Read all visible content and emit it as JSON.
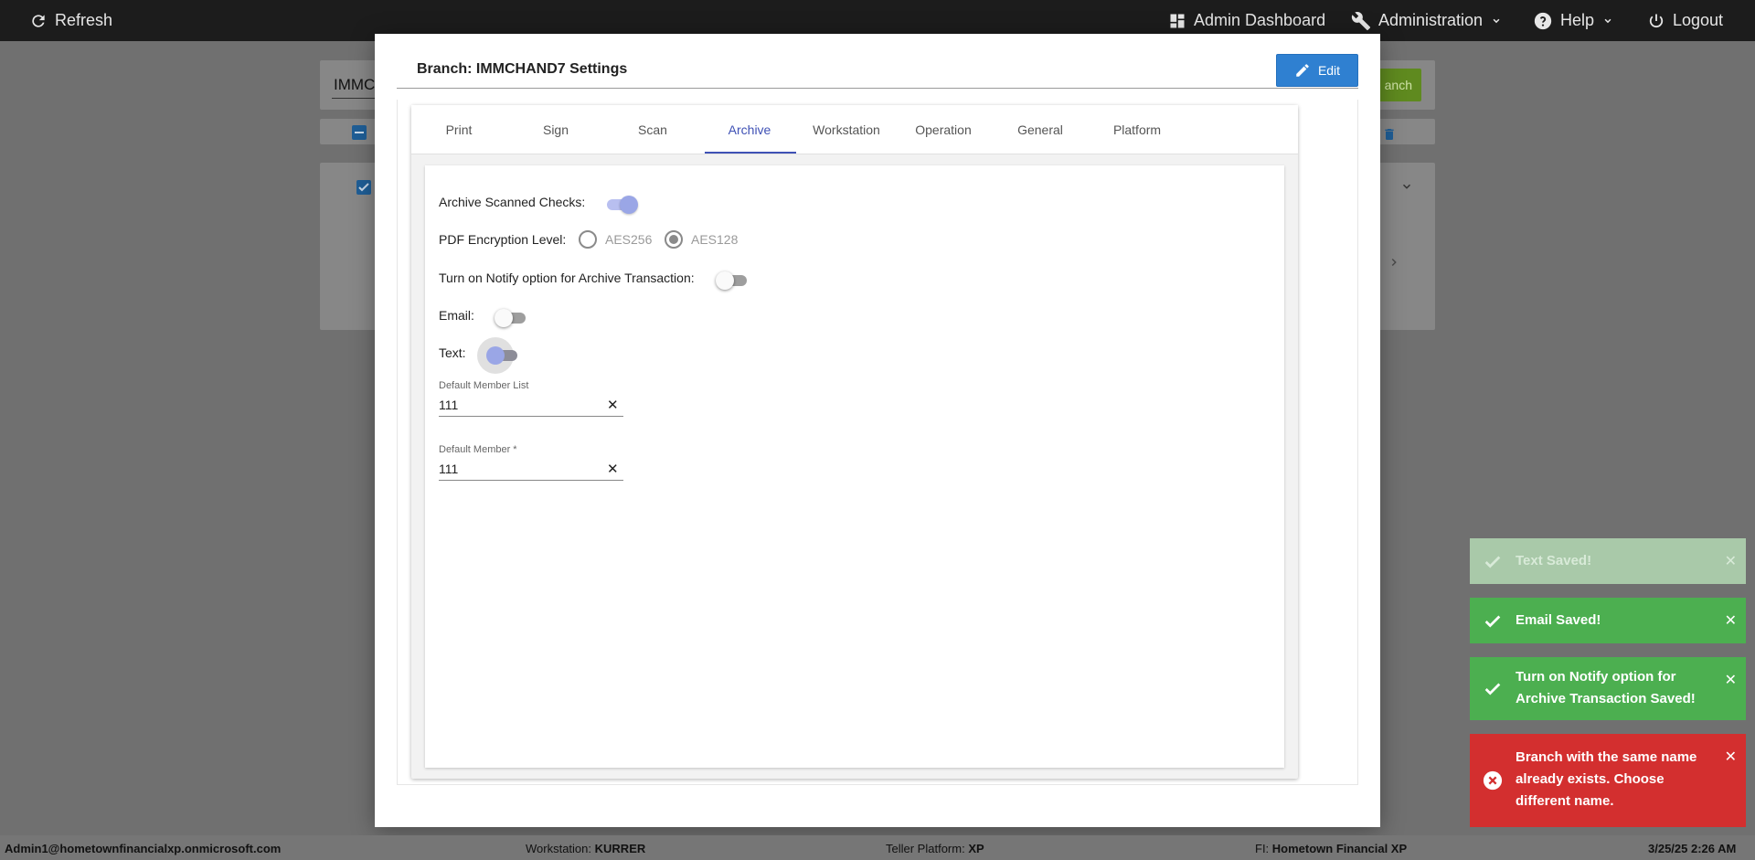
{
  "topbar": {
    "refresh_label": "Refresh",
    "admin_dashboard_label": "Admin Dashboard",
    "administration_label": "Administration",
    "help_label": "Help",
    "logout_label": "Logout"
  },
  "background": {
    "branch_input_text": "IMMC",
    "green_button_label": "anch"
  },
  "modal": {
    "title": "Branch: IMMCHAND7 Settings",
    "edit_label": "Edit",
    "tabs": [
      "Print",
      "Sign",
      "Scan",
      "Archive",
      "Workstation",
      "Operation",
      "General",
      "Platform"
    ],
    "active_tab": "Archive",
    "archive": {
      "archive_scanned_checks_label": "Archive Scanned Checks:",
      "archive_scanned_checks_on": true,
      "pdf_encryption_label": "PDF Encryption Level:",
      "encryption_options": [
        "AES256",
        "AES128"
      ],
      "encryption_selected": "AES128",
      "notify_label": "Turn on Notify option for Archive Transaction:",
      "notify_on": false,
      "email_label": "Email:",
      "email_on": false,
      "text_label": "Text:",
      "text_on": false,
      "default_member_list_label": "Default Member List",
      "default_member_list_value": "111",
      "default_member_label": "Default Member *",
      "default_member_value": "111"
    }
  },
  "toasts": [
    {
      "text": "Text Saved!",
      "type": "success-fading"
    },
    {
      "text": "Email Saved!",
      "type": "success"
    },
    {
      "text_lines": [
        "Turn on Notify option for",
        "Archive Transaction Saved!"
      ],
      "type": "success"
    },
    {
      "text_lines": [
        "Branch with the same name",
        "already exists. Choose",
        "different name."
      ],
      "type": "error"
    }
  ],
  "statusbar": {
    "user": "Admin1@hometownfinancialxp.onmicrosoft.com",
    "workstation_label": "Workstation:",
    "workstation_value": "KURRER",
    "teller_label": "Teller Platform:",
    "teller_value": "XP",
    "fi_label": "FI:",
    "fi_value": "Hometown Financial XP",
    "datetime": "3/25/25 2:26 AM"
  },
  "colors": {
    "primary": "#2f80d1",
    "tab_active": "#3f51b5",
    "success": "#4caf50",
    "error": "#d32f2f"
  }
}
